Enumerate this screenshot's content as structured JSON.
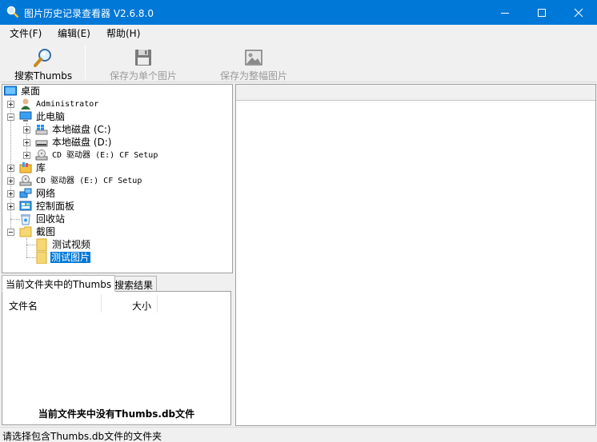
{
  "window": {
    "title": "图片历史记录查看器 V2.6.8.0",
    "controls": {
      "minimize": "minimize-icon",
      "maximize": "maximize-icon",
      "close": "close-icon"
    }
  },
  "menu": {
    "items": [
      {
        "label": "文件(F)"
      },
      {
        "label": "编辑(E)"
      },
      {
        "label": "帮助(H)"
      }
    ]
  },
  "toolbar": {
    "search_label": "搜索Thumbs",
    "save_single_label": "保存为单个图片",
    "save_whole_label": "保存为整幅图片"
  },
  "tree": {
    "desktop": "桌面",
    "administrator": "Administrator",
    "this_pc": "此电脑",
    "disk_c": "本地磁盘 (C:)",
    "disk_d": "本地磁盘 (D:)",
    "cd_drive_sub": "CD 驱动器 (E:) CF Setup",
    "library": "库",
    "cd_drive": "CD 驱动器 (E:) CF Setup",
    "network": "网络",
    "control_panel": "控制面板",
    "recycle_bin": "回收站",
    "screenshots": "截图",
    "test_video": "测试视频",
    "test_picture": "测试图片"
  },
  "tabs": [
    {
      "label": "当前文件夹中的Thumbs",
      "active": true
    },
    {
      "label": "搜索结果",
      "active": false
    }
  ],
  "list": {
    "columns": [
      "文件名",
      "大小"
    ],
    "empty_message": "当前文件夹中没有Thumbs.db文件"
  },
  "status": {
    "text": "请选择包含Thumbs.db文件的文件夹"
  },
  "colors": {
    "titlebar": "#0078d7",
    "selection": "#0078d7",
    "window_bg": "#f0f0f0"
  }
}
